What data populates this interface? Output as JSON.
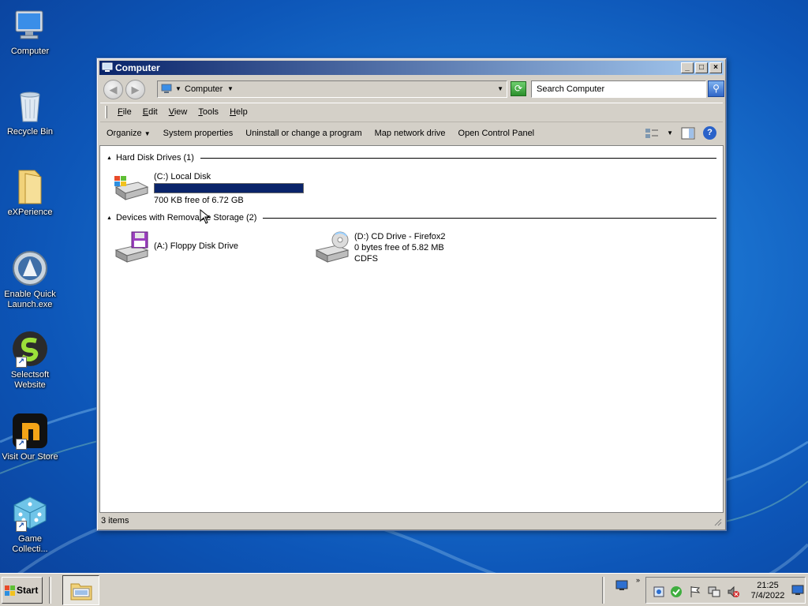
{
  "desktop": {
    "icons": [
      {
        "label": "Computer"
      },
      {
        "label": "Recycle Bin"
      },
      {
        "label": "eXPerience"
      },
      {
        "label": "Enable Quick Launch.exe"
      },
      {
        "label": "Selectsoft Website"
      },
      {
        "label": "Visit Our Store"
      },
      {
        "label": "Game Collecti..."
      }
    ]
  },
  "window": {
    "title": "Computer",
    "address": {
      "location": "Computer"
    },
    "search": {
      "placeholder": "Search Computer"
    },
    "menu": [
      "File",
      "Edit",
      "View",
      "Tools",
      "Help"
    ],
    "commands": [
      "Organize",
      "System properties",
      "Uninstall or change a program",
      "Map network drive",
      "Open Control Panel"
    ],
    "groups": {
      "hard_disks": {
        "header": "Hard Disk Drives (1)",
        "drives": [
          {
            "name": "(C:) Local Disk",
            "free": "700 KB free of 6.72 GB",
            "used_fraction": 0.9999
          }
        ]
      },
      "removable": {
        "header": "Devices with Removable Storage (2)",
        "drives": [
          {
            "name": "(A:) Floppy Disk Drive"
          },
          {
            "name": "(D:) CD Drive - Firefox2",
            "free": "0 bytes free of 5.82 MB",
            "fs": "CDFS"
          }
        ]
      }
    },
    "status": "3 items"
  },
  "taskbar": {
    "start_label": "Start",
    "clock": {
      "time": "21:25",
      "date": "7/4/2022"
    }
  }
}
